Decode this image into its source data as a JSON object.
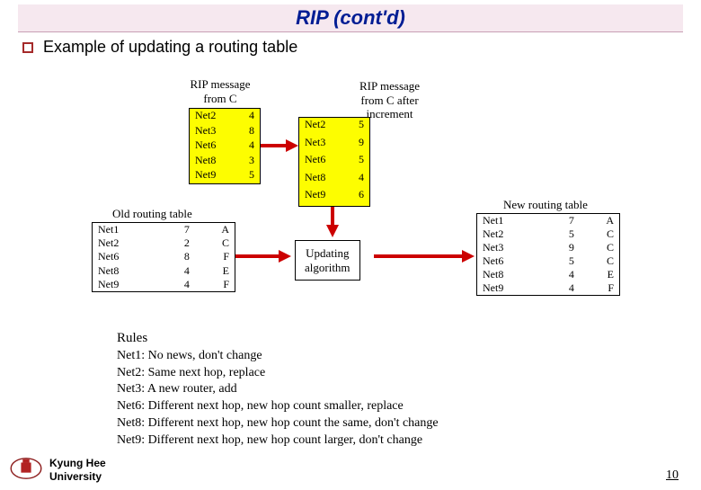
{
  "title": "RIP (cont'd)",
  "subtitle": "Example of updating a routing table",
  "labels": {
    "rip_from_c": "RIP message\nfrom C",
    "rip_after_inc": "RIP message\nfrom C after\nincrement",
    "old_table": "Old routing table",
    "new_table": "New routing table",
    "updating": "Updating\nalgorithm"
  },
  "rip_c": [
    {
      "net": "Net2",
      "hop": 4
    },
    {
      "net": "Net3",
      "hop": 8
    },
    {
      "net": "Net6",
      "hop": 4
    },
    {
      "net": "Net8",
      "hop": 3
    },
    {
      "net": "Net9",
      "hop": 5
    }
  ],
  "rip_inc": [
    {
      "net": "Net2",
      "hop": 5
    },
    {
      "net": "Net3",
      "hop": 9
    },
    {
      "net": "Net6",
      "hop": 5
    },
    {
      "net": "Net8",
      "hop": 4
    },
    {
      "net": "Net9",
      "hop": 6
    }
  ],
  "old_table": [
    {
      "net": "Net1",
      "hop": 7,
      "next": "A"
    },
    {
      "net": "Net2",
      "hop": 2,
      "next": "C"
    },
    {
      "net": "Net6",
      "hop": 8,
      "next": "F"
    },
    {
      "net": "Net8",
      "hop": 4,
      "next": "E"
    },
    {
      "net": "Net9",
      "hop": 4,
      "next": "F"
    }
  ],
  "new_table": [
    {
      "net": "Net1",
      "hop": 7,
      "next": "A"
    },
    {
      "net": "Net2",
      "hop": 5,
      "next": "C"
    },
    {
      "net": "Net3",
      "hop": 9,
      "next": "C"
    },
    {
      "net": "Net6",
      "hop": 5,
      "next": "C"
    },
    {
      "net": "Net8",
      "hop": 4,
      "next": "E"
    },
    {
      "net": "Net9",
      "hop": 4,
      "next": "F"
    }
  ],
  "rules_title": "Rules",
  "rules": [
    "Net1: No news, don't change",
    "Net2: Same next hop, replace",
    "Net3: A new router, add",
    "Net6: Different next hop, new hop count smaller, replace",
    "Net8: Different next hop, new hop count the same, don't change",
    "Net9: Different next hop, new hop count larger, don't change"
  ],
  "footer": {
    "line1": "Kyung Hee",
    "line2": "University"
  },
  "page_number": "10"
}
